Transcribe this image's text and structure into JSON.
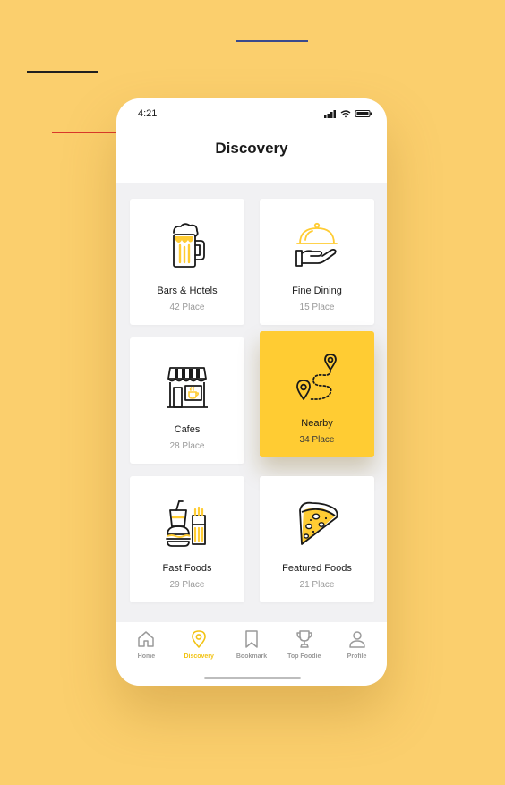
{
  "status": {
    "time": "4:21"
  },
  "header": {
    "title": "Discovery"
  },
  "categories": [
    {
      "label": "Bars  & Hotels",
      "count": "42 Place",
      "icon": "beer-mug-icon"
    },
    {
      "label": "Fine Dining",
      "count": "15 Place",
      "icon": "cloche-hand-icon"
    },
    {
      "label": "Cafes",
      "count": "28 Place",
      "icon": "cafe-storefront-icon"
    },
    {
      "label": "Nearby",
      "count": "34 Place",
      "icon": "route-pins-icon",
      "selected": true
    },
    {
      "label": "Fast Foods",
      "count": "29 Place",
      "icon": "burger-soda-icon"
    },
    {
      "label": "Featured Foods",
      "count": "21 Place",
      "icon": "pizza-slice-icon"
    }
  ],
  "tabs": [
    {
      "label": "Home",
      "icon": "home-icon"
    },
    {
      "label": "Discovery",
      "icon": "location-pin-icon",
      "active": true
    },
    {
      "label": "Bookmark",
      "icon": "bookmark-icon"
    },
    {
      "label": "Top Foodie",
      "icon": "trophy-icon"
    },
    {
      "label": "Profile",
      "icon": "user-icon"
    }
  ],
  "colors": {
    "background": "#FBCF6D",
    "accent": "#FFCC33",
    "active_tab": "#F2C314",
    "text": "#1A1A1A",
    "muted": "#9A9A9A"
  }
}
